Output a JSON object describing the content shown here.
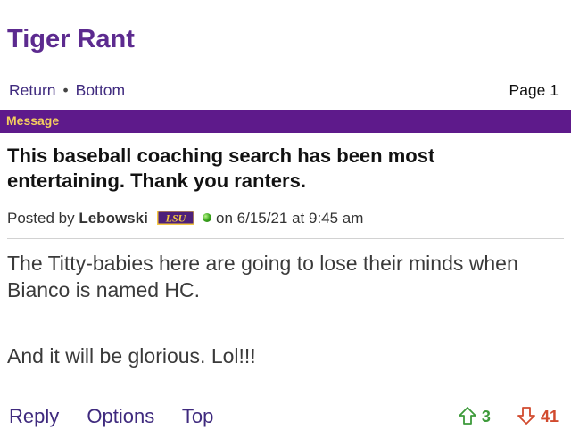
{
  "forum": {
    "title": "Tiger Rant"
  },
  "nav": {
    "return_label": "Return",
    "separator": "•",
    "bottom_label": "Bottom",
    "page_indicator": "Page 1"
  },
  "message_bar": {
    "label": "Message",
    "bg_color": "#5e1a8b",
    "text_color": "#f5cf5e"
  },
  "thread": {
    "title": "This baseball coaching search has been most entertaining. Thank you ranters."
  },
  "meta": {
    "posted_by": "Posted by",
    "author": "Lebowski",
    "badge_text": "LSU",
    "online_status_icon": "online-dot-icon",
    "timestamp": "on 6/15/21 at 9:45 am"
  },
  "post": {
    "paragraph_1": "The Titty-babies here are going to lose their minds when Bianco is named HC.",
    "paragraph_2": "And it will be glorious. Lol!!!"
  },
  "footer": {
    "reply_label": "Reply",
    "options_label": "Options",
    "top_label": "Top",
    "upvote_count": "3",
    "downvote_count": "41",
    "upvote_color": "#3d9a3a",
    "downvote_color": "#d14a2e"
  }
}
